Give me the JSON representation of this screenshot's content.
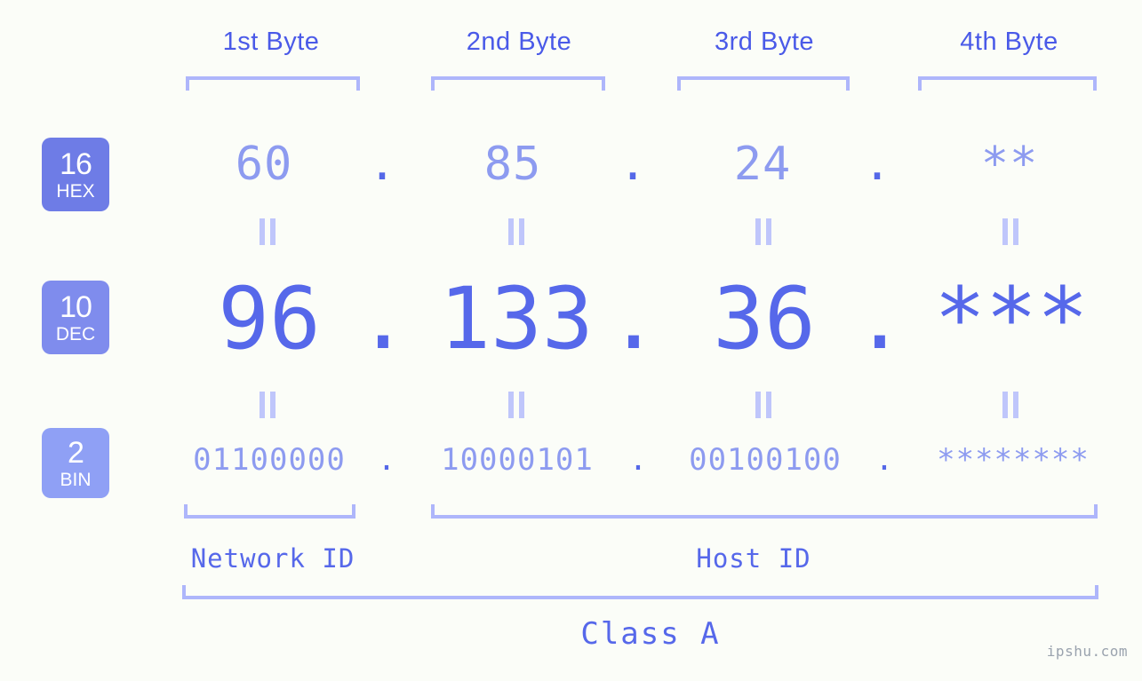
{
  "meta": {
    "watermark": "ipshu.com",
    "background": "#fbfdf8",
    "accent_dark": "#4a5ae8",
    "accent_mid": "#5668ea",
    "accent_light": "#8d9bf0",
    "accent_pale": "#aeb6fb"
  },
  "byte_headers": [
    {
      "label": "1st Byte"
    },
    {
      "label": "2nd Byte"
    },
    {
      "label": "3rd Byte"
    },
    {
      "label": "4th Byte"
    }
  ],
  "bases": [
    {
      "number": "16",
      "name": "HEX",
      "color": "#6e7ce6"
    },
    {
      "number": "10",
      "name": "DEC",
      "color": "#7f8ced"
    },
    {
      "number": "2",
      "name": "BIN",
      "color": "#8fa0f5"
    }
  ],
  "rows": {
    "hex": {
      "base_number": "16",
      "base_name": "HEX",
      "values": [
        "60",
        "85",
        "24",
        "**"
      ],
      "separator": "."
    },
    "dec": {
      "base_number": "10",
      "base_name": "DEC",
      "values": [
        "96",
        "133",
        "36",
        "***"
      ],
      "separator": "."
    },
    "bin": {
      "base_number": "2",
      "base_name": "BIN",
      "values": [
        "01100000",
        "10000101",
        "00100100",
        "********"
      ],
      "separator": "."
    }
  },
  "segments": {
    "network_id": "Network ID",
    "host_id": "Host ID",
    "class": "Class A"
  },
  "chart_data": {
    "type": "table",
    "title": "IP address byte breakdown",
    "columns": [
      "Base",
      "1st Byte",
      "2nd Byte",
      "3rd Byte",
      "4th Byte"
    ],
    "rows": [
      [
        "16 HEX",
        "60",
        "85",
        "24",
        "**"
      ],
      [
        "10 DEC",
        "96",
        "133",
        "36",
        "***"
      ],
      [
        "2 BIN",
        "01100000",
        "10000101",
        "00100100",
        "********"
      ]
    ],
    "network_id_bytes": 1,
    "host_id_bytes": 3,
    "address_class": "Class A"
  }
}
